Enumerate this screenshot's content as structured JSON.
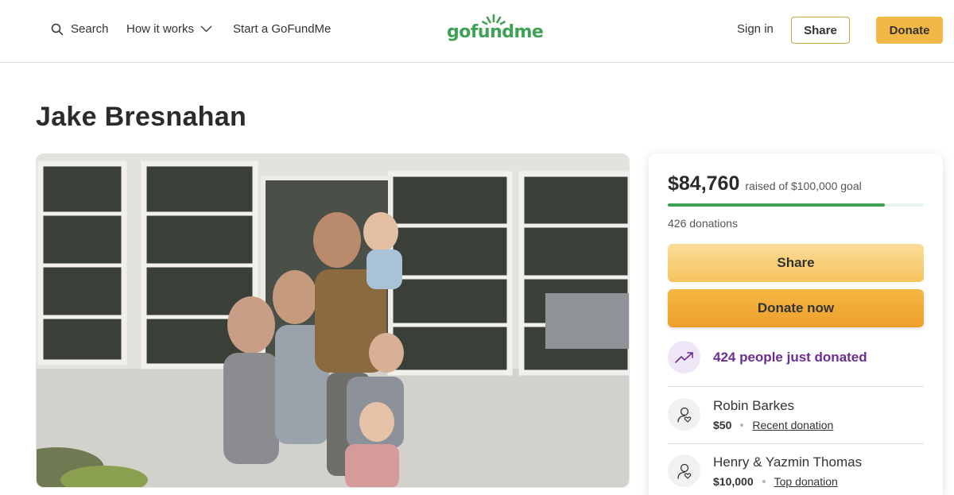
{
  "header": {
    "search_label": "Search",
    "how_it_works_label": "How it works",
    "start_label": "Start a GoFundMe",
    "logo_text": "gofundme",
    "signin_label": "Sign in",
    "share_label": "Share",
    "donate_label": "Donate"
  },
  "campaign": {
    "title": "Jake Bresnahan"
  },
  "sidebar": {
    "raised_amount": "$84,760",
    "raised_goal_text": "raised of $100,000 goal",
    "progress_fraction": 0.8476,
    "donation_count": "426 donations",
    "share_label": "Share",
    "donate_now_label": "Donate now",
    "recent_activity": "424 people just donated",
    "donors": [
      {
        "name": "Robin Barkes",
        "amount": "$50",
        "tag": "Recent donation"
      },
      {
        "name": "Henry & Yazmin Thomas",
        "amount": "$10,000",
        "tag": "Top donation"
      }
    ]
  },
  "colors": {
    "brand_green": "#3ea154",
    "donate_orange": "#f2b845",
    "activity_purple": "#6b2d92"
  },
  "icons": [
    "search-icon",
    "chevron-down-icon",
    "trending-up-icon",
    "donor-heart-icon"
  ]
}
